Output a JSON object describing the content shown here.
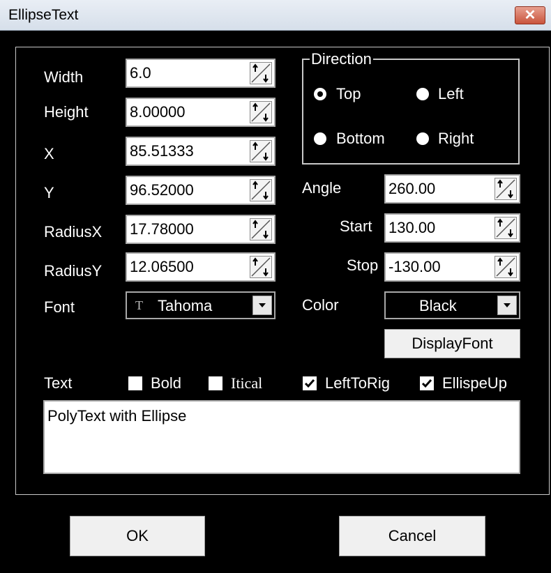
{
  "window": {
    "title": "EllipseText",
    "close_glyph": "✕"
  },
  "fields": [
    {
      "label": "Width",
      "value": "6.0"
    },
    {
      "label": "Height",
      "value": "8.00000"
    },
    {
      "label": "X",
      "value": "85.51333"
    },
    {
      "label": "Y",
      "value": "96.52000"
    },
    {
      "label": "RadiusX",
      "value": "17.78000"
    },
    {
      "label": "RadiusY",
      "value": "12.06500"
    }
  ],
  "font": {
    "label": "Font",
    "icon_glyph": "T",
    "value": "Tahoma"
  },
  "direction": {
    "title": "Direction",
    "options": [
      {
        "label": "Top",
        "selected": true
      },
      {
        "label": "Left",
        "selected": false
      },
      {
        "label": "Bottom",
        "selected": false
      },
      {
        "label": "Right",
        "selected": false
      }
    ]
  },
  "angle": {
    "label": "Angle",
    "value": "260.00"
  },
  "start": {
    "label": "Start",
    "value": "130.00"
  },
  "stop": {
    "label": "Stop",
    "value": "-130.00"
  },
  "color": {
    "label": "Color",
    "value": "Black"
  },
  "display_font_button": "DisplayFont",
  "text_label": "Text",
  "checkboxes": [
    {
      "label": "Bold",
      "checked": false
    },
    {
      "label": "Itical",
      "checked": false
    },
    {
      "label": "LeftToRig",
      "checked": true
    },
    {
      "label": "EllispeUp",
      "checked": true
    }
  ],
  "text_value": "PolyText with Ellipse",
  "buttons": {
    "ok": "OK",
    "cancel": "Cancel"
  }
}
